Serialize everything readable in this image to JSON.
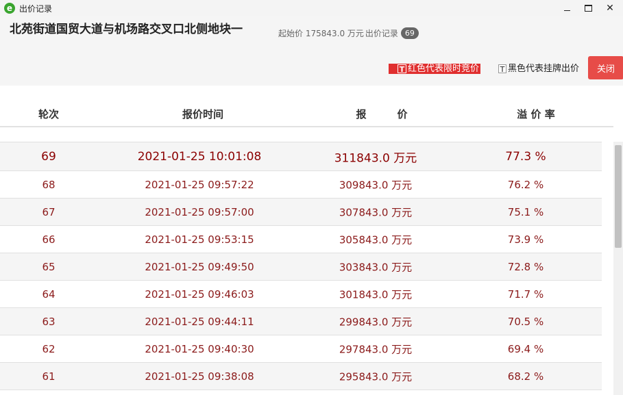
{
  "window": {
    "title": "出价记录",
    "minimize_glyph": "",
    "maximize_glyph": "",
    "close_glyph": "✕"
  },
  "header": {
    "title": "北苑街道国贸大道与机场路交叉口北侧地块一",
    "start_price_label": "起始价 175843.0 万元",
    "bid_record_label": "出价记录",
    "bid_count": "69",
    "legend_red_icon": "T",
    "legend_red_text": "红色代表限时竞价",
    "legend_black_icon": "T",
    "legend_black_text": "黑色代表挂牌出价",
    "close_label": "关闭"
  },
  "table": {
    "columns": [
      "轮次",
      "报价时间",
      "报　　　价",
      "溢 价 率"
    ],
    "rows": [
      {
        "round": "69",
        "time": "2021-01-25 10:01:08",
        "price": "311843.0 万元",
        "premium": "77.3 %"
      },
      {
        "round": "68",
        "time": "2021-01-25 09:57:22",
        "price": "309843.0 万元",
        "premium": "76.2 %"
      },
      {
        "round": "67",
        "time": "2021-01-25 09:57:00",
        "price": "307843.0 万元",
        "premium": "75.1 %"
      },
      {
        "round": "66",
        "time": "2021-01-25 09:53:15",
        "price": "305843.0 万元",
        "premium": "73.9 %"
      },
      {
        "round": "65",
        "time": "2021-01-25 09:49:50",
        "price": "303843.0 万元",
        "premium": "72.8 %"
      },
      {
        "round": "64",
        "time": "2021-01-25 09:46:03",
        "price": "301843.0 万元",
        "premium": "71.7 %"
      },
      {
        "round": "63",
        "time": "2021-01-25 09:44:11",
        "price": "299843.0 万元",
        "premium": "70.5 %"
      },
      {
        "round": "62",
        "time": "2021-01-25 09:40:30",
        "price": "297843.0 万元",
        "premium": "69.4 %"
      },
      {
        "round": "61",
        "time": "2021-01-25 09:38:08",
        "price": "295843.0 万元",
        "premium": "68.2 %"
      }
    ]
  },
  "colors": {
    "accent_red": "#e74c48",
    "text_dark_red": "#8b1a1a"
  }
}
